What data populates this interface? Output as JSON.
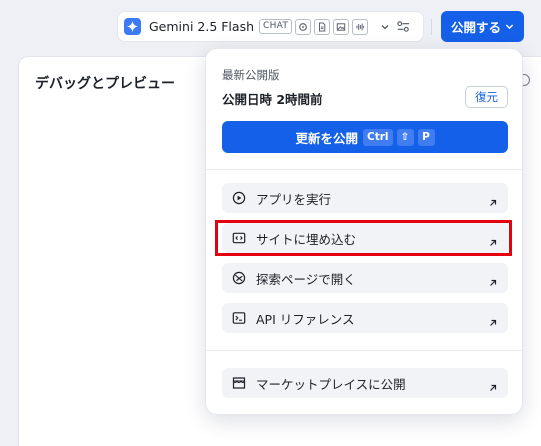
{
  "toolbar": {
    "model_name": "Gemini 2.5 Flash",
    "model_tag": "CHAT",
    "capability_icons": [
      "gear-sparkle-icon",
      "document-icon",
      "image-icon",
      "audio-wave-icon"
    ],
    "publish_label": "公開する",
    "accent_color": "#1560e8"
  },
  "panel": {
    "title": "デバッグとプレビュー"
  },
  "popover": {
    "latest_label": "最新公開版",
    "publish_time": "公開日時 2時間前",
    "restore_label": "復元",
    "update_label": "更新を公開",
    "shortcut_keys": [
      "Ctrl",
      "⇧",
      "P"
    ],
    "items": [
      {
        "label": "アプリを実行",
        "icon": "play-circle-icon"
      },
      {
        "label": "サイトに埋め込む",
        "icon": "embed-code-icon"
      },
      {
        "label": "探索ページで開く",
        "icon": "compass-icon"
      },
      {
        "label": "API リファレンス",
        "icon": "terminal-icon"
      },
      {
        "label": "マーケットプレイスに公開",
        "icon": "store-icon"
      }
    ]
  },
  "highlight_color": "#e5000f"
}
